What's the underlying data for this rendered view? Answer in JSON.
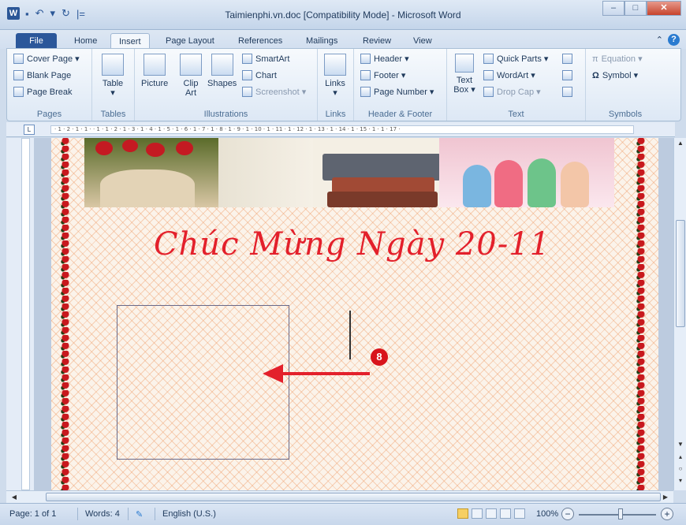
{
  "window": {
    "title": "Taimienphi.vn.doc [Compatibility Mode] - Microsoft Word"
  },
  "tabs": [
    "File",
    "Home",
    "Insert",
    "Page Layout",
    "References",
    "Mailings",
    "Review",
    "View"
  ],
  "active_tab": "Insert",
  "ribbon": {
    "pages": {
      "label": "Pages",
      "items": [
        "Cover Page ▾",
        "Blank Page",
        "Page Break"
      ]
    },
    "tables": {
      "label": "Tables",
      "button": "Table"
    },
    "illustrations": {
      "label": "Illustrations",
      "picture": "Picture",
      "clip_art": "Clip Art",
      "shapes": "Shapes",
      "smartart": "SmartArt",
      "chart": "Chart",
      "screenshot": "Screenshot ▾"
    },
    "links": {
      "label": "Links",
      "button": "Links"
    },
    "header_footer": {
      "label": "Header & Footer",
      "items": [
        "Header ▾",
        "Footer ▾",
        "Page Number ▾"
      ]
    },
    "text": {
      "label": "Text",
      "text_box": "Text Box ▾",
      "quick_parts": "Quick Parts ▾",
      "wordart": "WordArt ▾",
      "drop_cap": "Drop Cap ▾"
    },
    "symbols": {
      "label": "Symbols",
      "equation": "Equation ▾",
      "symbol": "Symbol ▾"
    }
  },
  "ruler": {
    "text": "· 1 · 2 · 1 · 1 · · 1 · 1 · 2 · 1 · 3 · 1 · 4 · 1 · 5 · 1 · 6 · 1 · 7 · 1 · 8 · 1 · 9 · 1 · 10 · 1 · 11 · 1 · 12 · 1 · 13 · 1 · 14 · 1 · 15 · 1 ·  1 · 17 ·"
  },
  "document": {
    "heading": "Chúc Mừng Ngày 20-11",
    "step_badge": "8"
  },
  "status": {
    "page": "Page: 1 of 1",
    "words": "Words: 4",
    "language": "English (U.S.)",
    "zoom": "100%"
  },
  "colors": {
    "accent": "#2b579a",
    "heading": "#e3202b",
    "annotation": "#d8131b"
  }
}
